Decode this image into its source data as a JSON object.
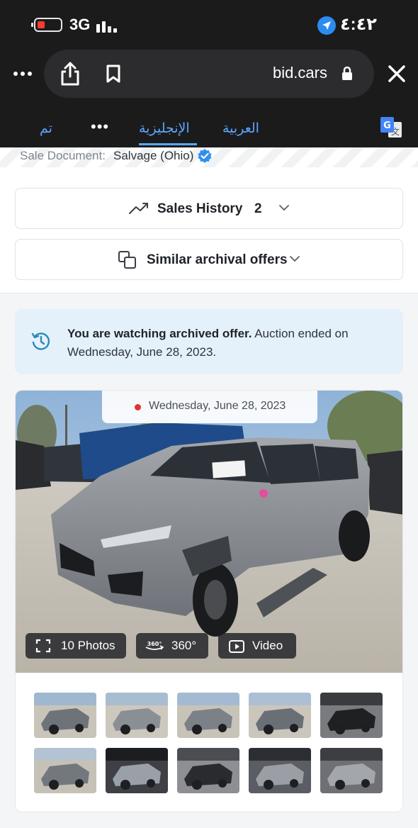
{
  "status_bar": {
    "network": "3G",
    "time": "٤:٤٢",
    "icons": [
      "battery-low-icon",
      "signal-bars-icon",
      "location-arrow-icon"
    ],
    "battery_color": "#ff3b30",
    "location_color": "#2b8cf0"
  },
  "browser": {
    "url": "bid.cars",
    "icons": [
      "more-dots-icon",
      "share-icon",
      "bookmark-icon",
      "lock-icon",
      "close-icon"
    ]
  },
  "translate_bar": {
    "done": "تم",
    "more": "•••",
    "english": "الإنجليزية",
    "arabic": "العربية",
    "accent": "#5aa7ff",
    "icons": [
      "google-translate-icon"
    ]
  },
  "sale_document": {
    "label": "Sale Document:",
    "value": "Salvage (Ohio)",
    "icons": [
      "verified-badge-icon"
    ]
  },
  "sections": {
    "sales_history": {
      "label": "Sales History",
      "count": "2"
    },
    "similar_offers": {
      "label": "Similar archival offers"
    }
  },
  "archive_notice": {
    "bold": "You are watching archived offer.",
    "rest": " Auction ended on Wednesday, June 28, 2023.",
    "background": "#e4f1fb"
  },
  "media": {
    "date": "Wednesday, June 28, 2023",
    "photos_label": "10 Photos",
    "badge_360": "360°",
    "degrees_label": "360°",
    "video_label": "Video",
    "thumbnail_count": 10
  }
}
